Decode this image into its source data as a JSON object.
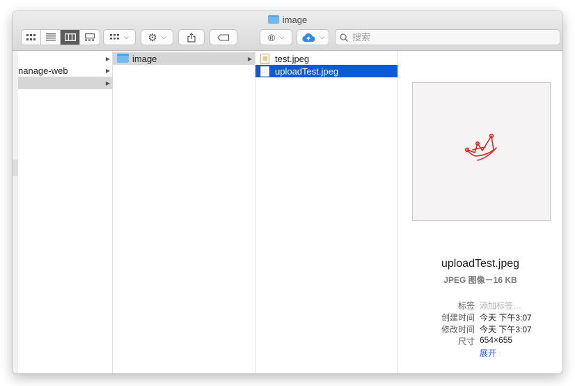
{
  "window": {
    "title": "image"
  },
  "toolbar": {
    "view_modes": [
      "icon-view",
      "list-view",
      "column-view",
      "gallery-view"
    ],
    "active_view": "column-view",
    "group_icon": "group-grid-icon",
    "action_icon": "gear-icon",
    "share_icon": "share-icon",
    "tag_icon": "tag-icon",
    "ext_icon": "registered-icon",
    "cloud_icon": "cloud-upload-icon",
    "search_placeholder": "搜索"
  },
  "columns": {
    "col1": [
      {
        "label": "",
        "has_arrow": true,
        "selected": false
      },
      {
        "label": "nanage-web",
        "has_arrow": true,
        "selected": false
      },
      {
        "label": "",
        "has_arrow": true,
        "selected": true
      }
    ],
    "col2": [
      {
        "label": "image",
        "has_arrow": true,
        "selected": true,
        "type": "folder"
      }
    ],
    "col3": [
      {
        "label": "test.jpeg",
        "selected": false,
        "type": "file"
      },
      {
        "label": "uploadTest.jpeg",
        "selected": true,
        "type": "file"
      }
    ]
  },
  "preview": {
    "file_name": "uploadTest.jpeg",
    "kind": "JPEG 图像－16 KB",
    "meta": [
      {
        "key": "标签",
        "value": "添加标签…",
        "placeholder": true
      },
      {
        "key": "创建时间",
        "value": "今天 下午3:07",
        "placeholder": false
      },
      {
        "key": "修改时间",
        "value": "今天 下午3:07",
        "placeholder": false
      },
      {
        "key": "尺寸",
        "value": "654×655",
        "placeholder": false
      }
    ],
    "show_more": "展开",
    "accent": "#e0261f"
  },
  "colors": {
    "selection_blue": "#0b5bd8",
    "selection_grey": "#d6d6d6"
  }
}
